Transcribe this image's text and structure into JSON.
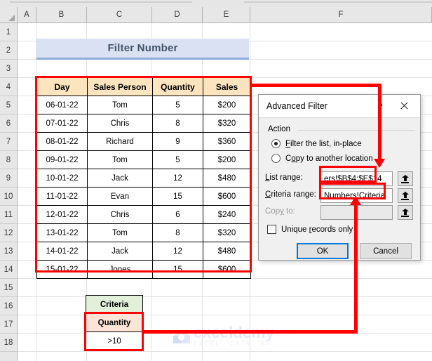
{
  "spreadsheet": {
    "column_headers": [
      "A",
      "B",
      "C",
      "D",
      "E",
      "F"
    ],
    "row_headers": [
      "1",
      "2",
      "3",
      "4",
      "5",
      "6",
      "7",
      "8",
      "9",
      "10",
      "11",
      "12",
      "13",
      "14",
      "15",
      "16",
      "17",
      "18"
    ],
    "banner_title": "Filter Number"
  },
  "data_table": {
    "headers": [
      "Day",
      "Sales Person",
      "Quantity",
      "Sales"
    ],
    "rows": [
      [
        "06-01-22",
        "Tom",
        "5",
        "$200"
      ],
      [
        "07-01-22",
        "Chris",
        "8",
        "$320"
      ],
      [
        "08-01-22",
        "Richard",
        "9",
        "$360"
      ],
      [
        "09-01-22",
        "Tom",
        "5",
        "$200"
      ],
      [
        "10-01-22",
        "Jack",
        "12",
        "$480"
      ],
      [
        "11-01-22",
        "Evan",
        "15",
        "$600"
      ],
      [
        "12-01-22",
        "Chris",
        "6",
        "$240"
      ],
      [
        "13-01-22",
        "Tom",
        "8",
        "$320"
      ],
      [
        "14-01-22",
        "Jack",
        "12",
        "$480"
      ],
      [
        "15-01-22",
        "Jones",
        "15",
        "$600"
      ]
    ]
  },
  "criteria_table": {
    "title": "Criteria",
    "field": "Quantity",
    "value": ">10"
  },
  "dialog": {
    "title": "Advanced Filter",
    "help_label": "?",
    "close_label": "×",
    "action_group_label": "Action",
    "radios": [
      {
        "label_pre": "",
        "accel": "F",
        "label_post": "ilter the list, in-place",
        "selected": true
      },
      {
        "label_pre": "C",
        "accel": "o",
        "label_post": "py to another location",
        "selected": false
      }
    ],
    "fields": [
      {
        "label_pre": "",
        "accel": "L",
        "label_post": "ist range:",
        "value": "ers!$B$4:$E$14",
        "disabled": false
      },
      {
        "label_pre": "",
        "accel": "C",
        "label_post": "riteria range:",
        "value": "Numbers!Criteria",
        "disabled": false
      },
      {
        "label_pre": "Cop",
        "accel": "y",
        "label_post": " to:",
        "value": "",
        "disabled": true
      }
    ],
    "checkbox": {
      "label_pre": "Unique ",
      "accel": "r",
      "label_post": "ecords only",
      "checked": false
    },
    "buttons": {
      "ok": "OK",
      "cancel": "Cancel"
    }
  },
  "watermark": {
    "name": "exceldemy",
    "tagline": "EXCEL · DATA · BI"
  },
  "colors": {
    "annotation_red": "#ff0000",
    "header_fill": "#fce4bf",
    "banner_fill": "#d9e1f2",
    "criteria_title_fill": "#e2efda",
    "criteria_field_fill": "#fce4d6",
    "focus_blue": "#0078d7"
  }
}
